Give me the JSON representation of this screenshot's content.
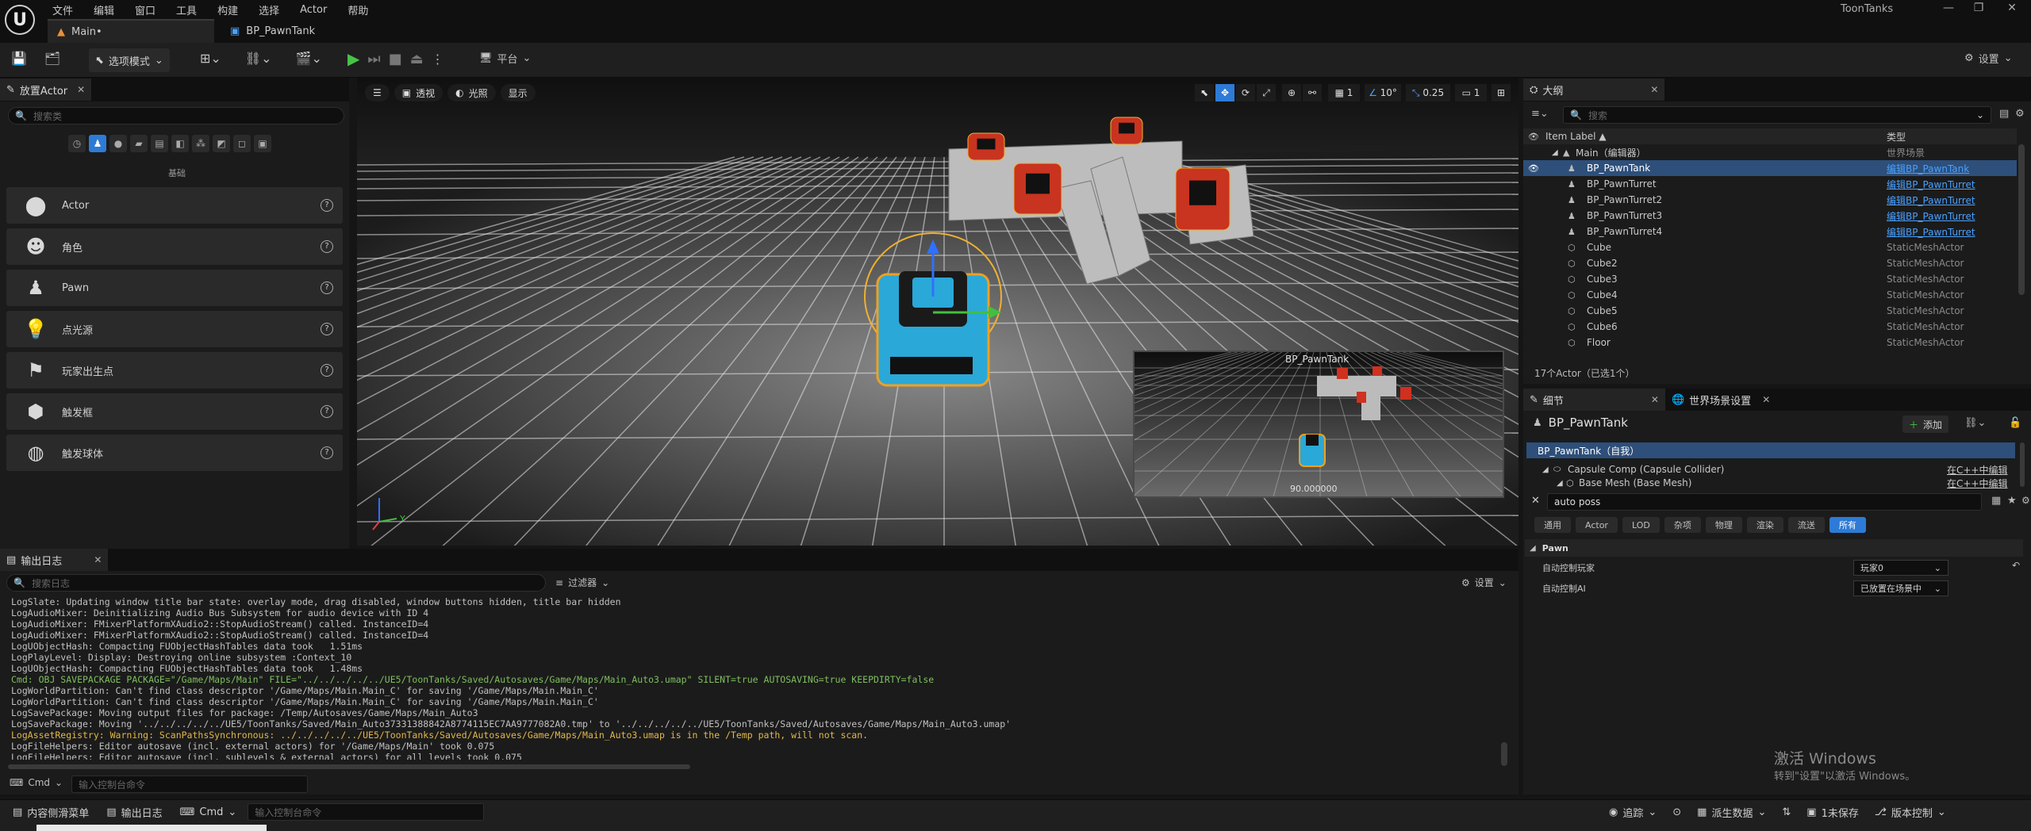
{
  "app": {
    "project": "ToonTanks",
    "logo": "U"
  },
  "menu": [
    "文件",
    "编辑",
    "窗口",
    "工具",
    "构建",
    "选择",
    "Actor",
    "帮助"
  ],
  "tabs": [
    {
      "label": "Main•"
    },
    {
      "label": "BP_PawnTank"
    }
  ],
  "toolbar": {
    "mode": "选项模式",
    "platform": "平台",
    "settings": "设置"
  },
  "place_actors": {
    "title": "放置Actor",
    "search_placeholder": "搜索类",
    "section": "基础",
    "items": [
      {
        "label": "Actor",
        "icon": "sphere-icon"
      },
      {
        "label": "角色",
        "icon": "character-icon"
      },
      {
        "label": "Pawn",
        "icon": "pawn-icon"
      },
      {
        "label": "点光源",
        "icon": "bulb-icon"
      },
      {
        "label": "玩家出生点",
        "icon": "player-start-icon"
      },
      {
        "label": "触发框",
        "icon": "trigger-box-icon"
      },
      {
        "label": "触发球体",
        "icon": "trigger-sphere-icon"
      }
    ]
  },
  "viewport": {
    "perspective": "透视",
    "lit": "光照",
    "show": "显示",
    "grid": "1",
    "rotation": "10°",
    "scale": "0.25",
    "cam": "1",
    "pip_title": "BP_PawnTank",
    "pip_value": "90.000000",
    "axis_y": "Y"
  },
  "outliner": {
    "title": "大纲",
    "search_placeholder": "搜索",
    "col_label": "Item Label ▲",
    "col_type": "类型",
    "root": {
      "label": "Main（编辑器）",
      "type": "世界场景"
    },
    "rows": [
      {
        "label": "BP_PawnTank",
        "type": "编辑BP_PawnTank",
        "link": true,
        "selected": true,
        "icon": "person-icon"
      },
      {
        "label": "BP_PawnTurret",
        "type": "编辑BP_PawnTurret",
        "link": true,
        "icon": "person-icon"
      },
      {
        "label": "BP_PawnTurret2",
        "type": "编辑BP_PawnTurret",
        "link": true,
        "icon": "person-icon"
      },
      {
        "label": "BP_PawnTurret3",
        "type": "编辑BP_PawnTurret",
        "link": true,
        "icon": "person-icon"
      },
      {
        "label": "BP_PawnTurret4",
        "type": "编辑BP_PawnTurret",
        "link": true,
        "icon": "person-icon"
      },
      {
        "label": "Cube",
        "type": "StaticMeshActor",
        "icon": "mesh-icon"
      },
      {
        "label": "Cube2",
        "type": "StaticMeshActor",
        "icon": "mesh-icon"
      },
      {
        "label": "Cube3",
        "type": "StaticMeshActor",
        "icon": "mesh-icon"
      },
      {
        "label": "Cube4",
        "type": "StaticMeshActor",
        "icon": "mesh-icon"
      },
      {
        "label": "Cube5",
        "type": "StaticMeshActor",
        "icon": "mesh-icon"
      },
      {
        "label": "Cube6",
        "type": "StaticMeshActor",
        "icon": "mesh-icon"
      },
      {
        "label": "Floor",
        "type": "StaticMeshActor",
        "icon": "mesh-icon"
      }
    ],
    "footer": "17个Actor（已选1个）"
  },
  "details": {
    "tab1": "细节",
    "tab2": "世界场景设置",
    "object": "BP_PawnTank",
    "add": "添加",
    "components": [
      {
        "label": "BP_PawnTank（自我）",
        "right": ""
      },
      {
        "label": "Capsule Comp (Capsule Collider)",
        "right": "在C++中编辑"
      },
      {
        "label": "Base Mesh (Base Mesh)",
        "right": "在C++中编辑"
      }
    ],
    "search_value": "auto poss",
    "filters": [
      "通用",
      "Actor",
      "LOD",
      "杂项",
      "物理",
      "渲染",
      "流送",
      "所有"
    ],
    "section": "Pawn",
    "props": [
      {
        "label": "自动控制玩家",
        "value": "玩家0"
      },
      {
        "label": "自动控制AI",
        "value": "已放置在场景中"
      }
    ],
    "watermark_title": "激活 Windows",
    "watermark_sub": "转到\"设置\"以激活 Windows。"
  },
  "log": {
    "title": "输出日志",
    "search_placeholder": "搜索日志",
    "filters": "过滤器",
    "settings": "设置",
    "lines": [
      {
        "t": "LogSlate: Updating window title bar state: overlay mode, drag disabled, window buttons hidden, title bar hidden",
        "k": ""
      },
      {
        "t": "LogAudioMixer: Deinitializing Audio Bus Subsystem for audio device with ID 4",
        "k": ""
      },
      {
        "t": "LogAudioMixer: FMixerPlatformXAudio2::StopAudioStream() called. InstanceID=4",
        "k": ""
      },
      {
        "t": "LogAudioMixer: FMixerPlatformXAudio2::StopAudioStream() called. InstanceID=4",
        "k": ""
      },
      {
        "t": "LogUObjectHash: Compacting FUObjectHashTables data took   1.51ms",
        "k": ""
      },
      {
        "t": "LogPlayLevel: Display: Destroying online subsystem :Context_10",
        "k": ""
      },
      {
        "t": "LogUObjectHash: Compacting FUObjectHashTables data took   1.48ms",
        "k": ""
      },
      {
        "t": "Cmd: OBJ SAVEPACKAGE PACKAGE=\"/Game/Maps/Main\" FILE=\"../../../../../UE5/ToonTanks/Saved/Autosaves/Game/Maps/Main_Auto3.umap\" SILENT=true AUTOSAVING=true KEEPDIRTY=false",
        "k": "cmd"
      },
      {
        "t": "LogWorldPartition: Can't find class descriptor '/Game/Maps/Main.Main_C' for saving '/Game/Maps/Main.Main_C'",
        "k": ""
      },
      {
        "t": "LogWorldPartition: Can't find class descriptor '/Game/Maps/Main.Main_C' for saving '/Game/Maps/Main.Main_C'",
        "k": ""
      },
      {
        "t": "LogSavePackage: Moving output files for package: /Temp/Autosaves/Game/Maps/Main_Auto3",
        "k": ""
      },
      {
        "t": "LogSavePackage: Moving '../../../../../UE5/ToonTanks/Saved/Main_Auto37331388842A8774115EC7AA9777082A0.tmp' to '../../../../../UE5/ToonTanks/Saved/Autosaves/Game/Maps/Main_Auto3.umap'",
        "k": ""
      },
      {
        "t": "LogAssetRegistry: Warning: ScanPathsSynchronous: ../../../../../UE5/ToonTanks/Saved/Autosaves/Game/Maps/Main_Auto3.umap is in the /Temp path, will not scan.",
        "k": "warn"
      },
      {
        "t": "LogFileHelpers: Editor autosave (incl. external actors) for '/Game/Maps/Main' took 0.075",
        "k": ""
      },
      {
        "t": "LogFileHelpers: Editor autosave (incl. sublevels & external actors) for all levels took 0.075",
        "k": ""
      }
    ],
    "cmd_label": "Cmd",
    "cmd_placeholder": "输入控制台命令"
  },
  "status": {
    "content": "内容侧滑菜单",
    "log": "输出日志",
    "cmd": "Cmd",
    "cmd_placeholder": "输入控制台命令",
    "trace": "追踪",
    "derived": "派生数据",
    "unsaved": "1未保存",
    "source": "版本控制"
  }
}
